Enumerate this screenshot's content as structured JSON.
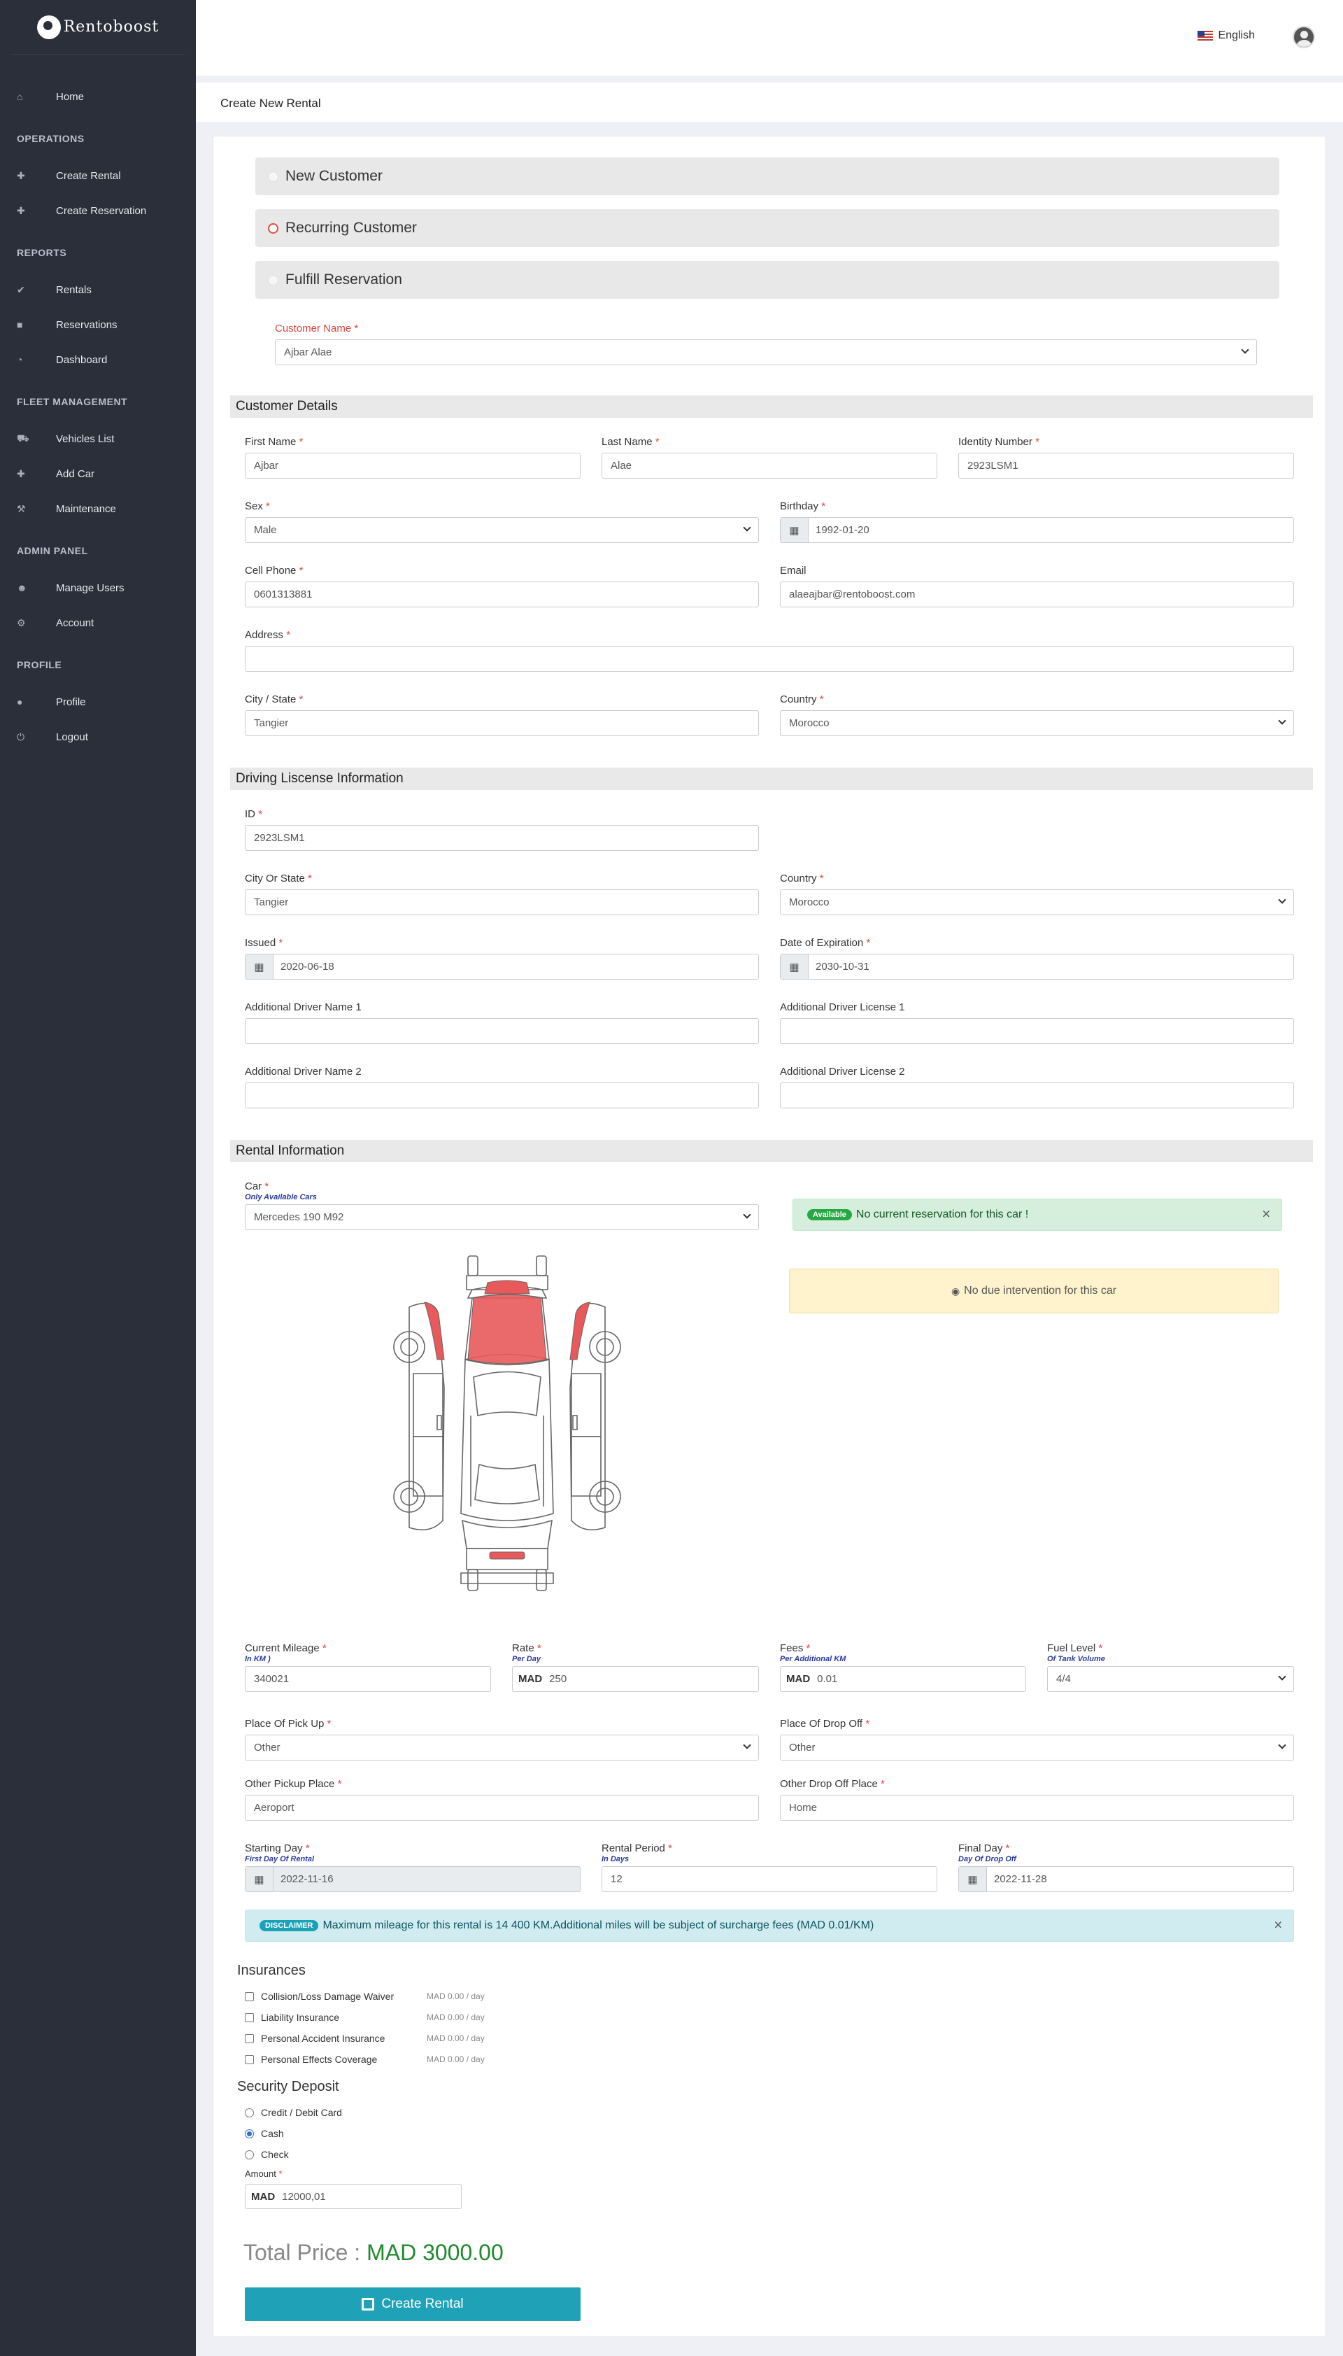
{
  "app": {
    "name": "Rentoboost"
  },
  "sidebar": {
    "home": "Home",
    "operations": {
      "title": "OPERATIONS",
      "items": [
        "Create Rental",
        "Create Reservation"
      ]
    },
    "reports": {
      "title": "REPORTS",
      "items": [
        "Rentals",
        "Reservations",
        "Dashboard"
      ]
    },
    "fleet": {
      "title": "FLEET MANAGEMENT",
      "items": [
        "Vehicles List",
        "Add Car",
        "Maintenance"
      ]
    },
    "admin": {
      "title": "ADMIN PANEL",
      "items": [
        "Manage Users",
        "Account"
      ]
    },
    "profile": {
      "title": "PROFILE",
      "items": [
        "Profile",
        "Logout"
      ]
    }
  },
  "topbar": {
    "language": "English"
  },
  "page": {
    "title": "Create New Rental"
  },
  "customer_type": {
    "options": [
      "New Customer",
      "Recurring Customer",
      "Fulfill Reservation"
    ],
    "selected": "Recurring Customer"
  },
  "customer_select": {
    "label": "Customer Name",
    "value": "Ajbar Alae"
  },
  "sections": {
    "customer": "Customer Details",
    "license": "Driving Liscense Information",
    "rental": "Rental Information"
  },
  "customer": {
    "first_name": {
      "label": "First Name",
      "value": "Ajbar"
    },
    "last_name": {
      "label": "Last Name",
      "value": "Alae"
    },
    "identity": {
      "label": "Identity Number",
      "value": "2923LSM1"
    },
    "sex": {
      "label": "Sex",
      "value": "Male"
    },
    "birthday": {
      "label": "Birthday",
      "value": "1992-01-20"
    },
    "phone": {
      "label": "Cell Phone",
      "value": "0601313881"
    },
    "email": {
      "label": "Email",
      "value": "alaeajbar@rentoboost.com"
    },
    "address": {
      "label": "Address",
      "value": ""
    },
    "city": {
      "label": "City / State",
      "value": "Tangier"
    },
    "country": {
      "label": "Country",
      "value": "Morocco"
    }
  },
  "license": {
    "id": {
      "label": "ID",
      "value": "2923LSM1"
    },
    "city": {
      "label": "City Or State",
      "value": "Tangier"
    },
    "country": {
      "label": "Country",
      "value": "Morocco"
    },
    "issued": {
      "label": "Issued",
      "value": "2020-06-18"
    },
    "expiration": {
      "label": "Date of Expiration",
      "value": "2030-10-31"
    },
    "driver1_name": {
      "label": "Additional Driver Name 1",
      "value": ""
    },
    "driver1_license": {
      "label": "Additional Driver License 1",
      "value": ""
    },
    "driver2_name": {
      "label": "Additional Driver Name 2",
      "value": ""
    },
    "driver2_license": {
      "label": "Additional Driver License 2",
      "value": ""
    }
  },
  "rental": {
    "car": {
      "label": "Car",
      "sub": "Only Available Cars",
      "value": "Mercedes 190 M92"
    },
    "available_alert": {
      "badge": "Available",
      "text": "No current reservation for this car !"
    },
    "intervention_alert": {
      "text": "No due intervention for this car"
    },
    "mileage": {
      "label": "Current Mileage",
      "sub": "In KM )",
      "value": "340021"
    },
    "rate": {
      "label": "Rate",
      "sub": "Per Day",
      "currency": "MAD",
      "value": "250"
    },
    "fees": {
      "label": "Fees",
      "sub": "Per Additional KM",
      "currency": "MAD",
      "value": "0.01"
    },
    "fuel": {
      "label": "Fuel Level",
      "sub": "Of Tank Volume",
      "value": "4/4"
    },
    "pickup": {
      "label": "Place Of Pick Up",
      "value": "Other"
    },
    "dropoff": {
      "label": "Place Of Drop Off",
      "value": "Other"
    },
    "other_pickup": {
      "label": "Other Pickup Place",
      "value": "Aeroport"
    },
    "other_dropoff": {
      "label": "Other Drop Off Place",
      "value": "Home"
    },
    "start": {
      "label": "Starting Day",
      "sub": "First Day Of Rental",
      "value": "2022-11-16"
    },
    "period": {
      "label": "Rental Period",
      "sub": "In Days",
      "value": "12"
    },
    "final": {
      "label": "Final Day",
      "sub": "Day Of Drop Off",
      "value": "2022-11-28"
    },
    "disclaimer": {
      "badge": "DISCLAIMER",
      "text": "Maximum mileage for this rental is 14 400 KM.Additional miles will be subject of surcharge fees (MAD 0.01/KM)"
    }
  },
  "insurances": {
    "title": "Insurances",
    "items": [
      {
        "label": "Collision/Loss Damage Waiver",
        "price": "MAD 0.00 / day"
      },
      {
        "label": "Liability Insurance",
        "price": "MAD 0.00 / day"
      },
      {
        "label": "Personal Accident Insurance",
        "price": "MAD 0.00 / day"
      },
      {
        "label": "Personal Effects Coverage",
        "price": "MAD 0.00 / day"
      }
    ]
  },
  "deposit": {
    "title": "Security Deposit",
    "options": [
      "Credit / Debit Card",
      "Cash",
      "Check"
    ],
    "selected": "Cash",
    "amount_label": "Amount",
    "currency": "MAD",
    "amount": "12000,01"
  },
  "total": {
    "label": "Total Price :",
    "value": "MAD 3000.00"
  },
  "submit": {
    "label": "Create Rental"
  },
  "colors": {
    "sidebar": "#2a2f3a",
    "accent": "#1fa2b8",
    "required": "#e0443a",
    "total": "#1f8a2f",
    "damage": "#e8595b"
  }
}
